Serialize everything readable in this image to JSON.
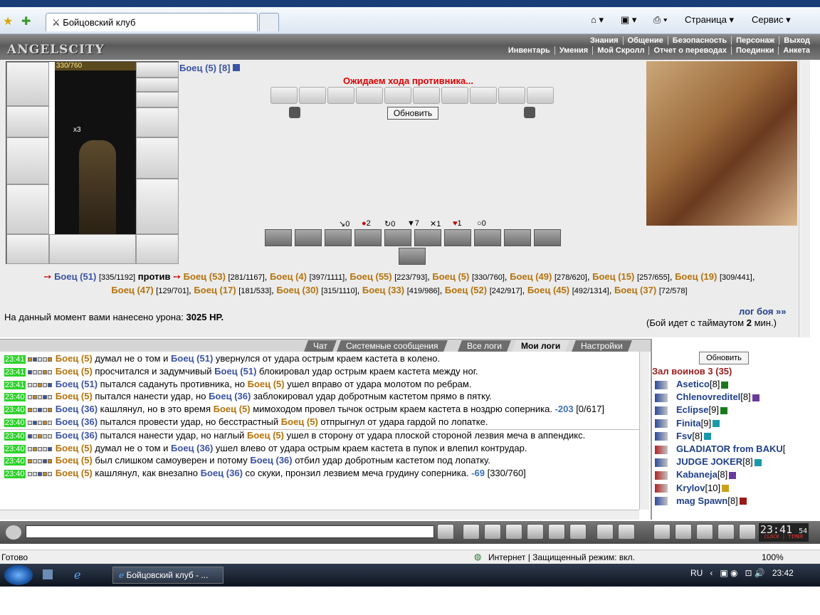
{
  "browser": {
    "tab_title": "Бойцовский клуб",
    "toolbar": {
      "page_label": "Страница",
      "service_label": "Сервис"
    },
    "status": {
      "text": "Готово",
      "zone": "Интернет | Защищенный режим: вкл.",
      "zoom": "100%"
    }
  },
  "site": {
    "logo": "ANGELSCITY",
    "menu_top": [
      "Знания",
      "Общение",
      "Безопасность",
      "Персонаж",
      "Выход"
    ],
    "menu_bottom": [
      "Инвентарь",
      "Умения",
      "Мой Скролл",
      "Отчет о переводах",
      "Поединки",
      "Анкета"
    ]
  },
  "battle": {
    "hp": "330/760",
    "item_count": "x3",
    "fighter_title": "Боец (5) [8]",
    "waiting": "Ожидаем хода противника...",
    "refresh_label": "Обновить",
    "stats": [
      "0",
      "2",
      "0",
      "7",
      "1",
      "1",
      "0"
    ],
    "vs_word": "против",
    "left_team": [
      {
        "name": "Боец (51)",
        "hp": "[335/1192]"
      }
    ],
    "right_team": [
      {
        "name": "Боец (53)",
        "hp": "[281/1167]"
      },
      {
        "name": "Боец (4)",
        "hp": "[397/1111]"
      },
      {
        "name": "Боец (55)",
        "hp": "[223/793]"
      },
      {
        "name": "Боец (5)",
        "hp": "[330/760]"
      },
      {
        "name": "Боец (49)",
        "hp": "[278/620]"
      },
      {
        "name": "Боец (15)",
        "hp": "[257/655]"
      },
      {
        "name": "Боец (19)",
        "hp": "[309/441]"
      },
      {
        "name": "Боец (47)",
        "hp": "[129/701]"
      },
      {
        "name": "Боец (17)",
        "hp": "[181/533]"
      },
      {
        "name": "Боец (30)",
        "hp": "[315/1110]"
      },
      {
        "name": "Боец (33)",
        "hp": "[419/986]"
      },
      {
        "name": "Боец (52)",
        "hp": "[242/917]"
      },
      {
        "name": "Боец (45)",
        "hp": "[492/1314]"
      },
      {
        "name": "Боец (37)",
        "hp": "[72/578]"
      }
    ],
    "damage_text": "На данный момент вами нанесено урона:",
    "damage_value": "3025 HP.",
    "fightlog_link": "лог боя »»",
    "timeout_prefix": "(Бой идет с таймаутом",
    "timeout_value": "2",
    "timeout_suffix": "мин.)"
  },
  "chat_tabs": [
    "Чат",
    "Системные сообщения",
    "Все логи",
    "Мои логи",
    "Настройки"
  ],
  "log": [
    {
      "time": "23:41",
      "a": "Боец (5)",
      "t1": " думал не о том и ",
      "b": "Боец (51)",
      "t2": " увернулся от удара острым краем кастета в колено.",
      "d": "",
      "hp": ""
    },
    {
      "time": "23:41",
      "a": "Боец (5)",
      "t1": " просчитался и задумчивый ",
      "b": "Боец (51)",
      "t2": " блокировал удар острым краем кастета между ног.",
      "d": "",
      "hp": ""
    },
    {
      "time": "23:41",
      "a": "Боец (51)",
      "t1": " пытался садануть противника, но ",
      "b": "Боец (5)",
      "t2": " ушел вправо от удара молотом по ребрам.",
      "d": "",
      "hp": ""
    },
    {
      "time": "23:40",
      "a": "Боец (5)",
      "t1": " пытался нанести удар, но ",
      "b": "Боец (36)",
      "t2": " заблокировал удар добротным кастетом прямо в пятку.",
      "d": "",
      "hp": ""
    },
    {
      "time": "23:40",
      "a": "Боец (36)",
      "t1": " кашлянул, но в это время ",
      "b": "Боец (5)",
      "t2": " мимоходом провел тычок острым краем кастета в ноздрю соперника.",
      "d": " -203",
      "hp": " [0/617]"
    },
    {
      "time": "23:40",
      "a": "Боец (36)",
      "t1": " пытался провести удар, но бесстрастный ",
      "b": "Боец (5)",
      "t2": " отпрыгнул от удара гардой по лопатке.",
      "d": "",
      "hp": ""
    },
    {
      "time": "23:40",
      "a": "Боец (36)",
      "t1": " пытался нанести удар, но наглый ",
      "b": "Боец (5)",
      "t2": " ушел в сторону от удара плоской стороной лезвия меча в аппендикс.",
      "d": "",
      "hp": ""
    },
    {
      "time": "23:40",
      "a": "Боец (5)",
      "t1": " думал не о том и ",
      "b": "Боец (36)",
      "t2": " ушел влево от удара острым краем кастета в пупок и влепил контрудар.",
      "d": "",
      "hp": ""
    },
    {
      "time": "23:40",
      "a": "Боец (5)",
      "t1": " был слишком самоуверен и потому ",
      "b": "Боец (36)",
      "t2": " отбил удар добротным кастетом под лопатку.",
      "d": "",
      "hp": ""
    },
    {
      "time": "23:40",
      "a": "Боец (5)",
      "t1": " кашлянул, как внезапно ",
      "b": "Боец (36)",
      "t2": " со скуки, пронзил лезвием меча грудину соперника.",
      "d": " -69",
      "hp": " [330/760]"
    }
  ],
  "players_panel": {
    "refresh_label": "Обновить",
    "hall": "Зал воинов 3 (35)",
    "players": [
      {
        "name": "Asetico",
        "level": "[8]"
      },
      {
        "name": "Chlenovreditel",
        "level": "[8]"
      },
      {
        "name": "Eclipse",
        "level": "[9]"
      },
      {
        "name": "Finita",
        "level": "[9]"
      },
      {
        "name": "Fsv",
        "level": "[8]"
      },
      {
        "name": "GLADIATOR from BAKU",
        "level": "["
      },
      {
        "name": "JUDGE JOKER",
        "level": "[8]"
      },
      {
        "name": "Kabaneja",
        "level": "[8]"
      },
      {
        "name": "Krylov",
        "level": "[10]"
      },
      {
        "name": "mag Spawn",
        "level": "[8]"
      }
    ]
  },
  "clock": {
    "time": "23:41",
    "seconds": "54",
    "labels": "CLOCK | TIMER"
  },
  "taskbar": {
    "item": "Бойцовский клуб - ...",
    "lang": "RU",
    "time": "23:42"
  },
  "colors": {
    "fighter": "#b5730c",
    "self": "#3a53a4",
    "waiting": "#e00000",
    "time_bg": "#2cd329"
  }
}
